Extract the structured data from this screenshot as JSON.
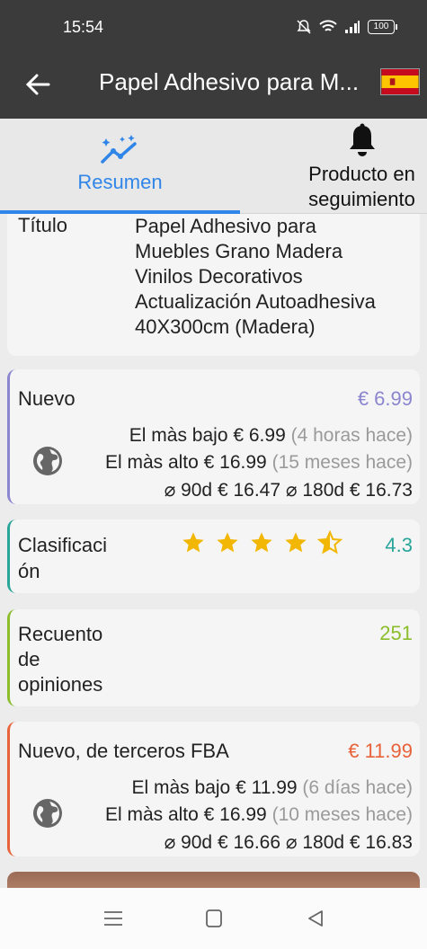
{
  "status": {
    "time": "15:54",
    "battery": "100"
  },
  "appbar": {
    "title": "Papel Adhesivo para M...",
    "flag_icon": "spain-flag-icon"
  },
  "tabs": [
    {
      "label": "Resumen",
      "icon": "sparkle-chart-icon",
      "active": true
    },
    {
      "label_line1": "Producto en",
      "label_line2": "seguimiento",
      "icon": "bell-icon"
    }
  ],
  "title_card": {
    "label": "Título",
    "lines": [
      "Papel Adhesivo para",
      "Muebles Grano Madera",
      "Vinilos Decorativos",
      "Actualización Autoadhesiva",
      "40X300cm (Madera)"
    ]
  },
  "new_price": {
    "name": "Nuevo",
    "price": "€ 6.99",
    "low_label": "El màs bajo",
    "low_value": "€ 6.99",
    "low_when": "(4 horas hace)",
    "high_label": "El màs alto",
    "high_value": "€ 16.99",
    "high_when": "(15 meses hace)",
    "avg90_label": "⌀ 90d",
    "avg90_value": "€ 16.47",
    "avg180_label": "⌀ 180d",
    "avg180_value": "€ 16.73"
  },
  "rating": {
    "name_line1": "Clasificaci",
    "name_line2": "ón",
    "score": "4.3",
    "stars_value": 4.3
  },
  "reviews": {
    "name_line1": "Recuento",
    "name_line2": "de",
    "name_line3": "opiniones",
    "count": "251"
  },
  "fba_price": {
    "name": "Nuevo, de terceros FBA",
    "price": "€ 11.99",
    "low_label": "El màs bajo",
    "low_value": "€ 11.99",
    "low_when": "(6 días hace)",
    "high_label": "El màs alto",
    "high_value": "€ 16.99",
    "high_when": "(10 meses hace)",
    "avg90_label": "⌀ 90d",
    "avg90_value": "€ 16.66",
    "avg180_label": "⌀ 180d",
    "avg180_value": "€ 16.83"
  },
  "colors": {
    "accent": "#2f86e8",
    "new": "#8b86cf",
    "rating": "#2aa59a",
    "reviews": "#8cbe2c",
    "fba": "#e8623a",
    "star": "#f2b705"
  }
}
